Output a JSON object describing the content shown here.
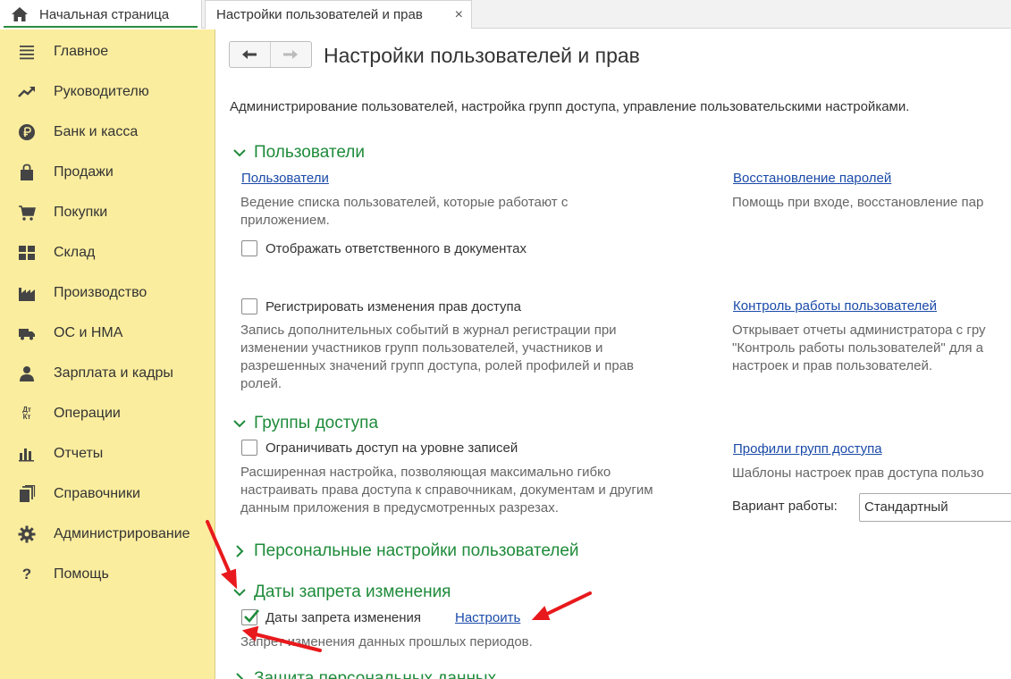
{
  "tabs": {
    "home_label": "Начальная страница",
    "active_label": "Настройки пользователей и прав",
    "close_glyph": "×"
  },
  "sidebar": {
    "items": [
      {
        "label": "Главное",
        "icon": "menu-lines-icon"
      },
      {
        "label": "Руководителю",
        "icon": "trend-up-icon"
      },
      {
        "label": "Банк и касса",
        "icon": "ruble-coin-icon"
      },
      {
        "label": "Продажи",
        "icon": "shopping-bag-icon"
      },
      {
        "label": "Покупки",
        "icon": "cart-icon"
      },
      {
        "label": "Склад",
        "icon": "warehouse-grid-icon"
      },
      {
        "label": "Производство",
        "icon": "factory-icon"
      },
      {
        "label": "ОС и НМА",
        "icon": "truck-icon"
      },
      {
        "label": "Зарплата и кадры",
        "icon": "person-icon"
      },
      {
        "label": "Операции",
        "icon": "debit-credit-icon"
      },
      {
        "label": "Отчеты",
        "icon": "bar-chart-icon"
      },
      {
        "label": "Справочники",
        "icon": "books-icon"
      },
      {
        "label": "Администрирование",
        "icon": "gear-icon"
      },
      {
        "label": "Помощь",
        "icon": "question-icon"
      }
    ],
    "debit_credit_text": "Дт Кт",
    "help_glyph": "?"
  },
  "header": {
    "back_glyph": "🡐",
    "forward_glyph": "🡒",
    "title": "Настройки пользователей и прав",
    "description": "Администрирование пользователей, настройка групп доступа, управление пользовательскими настройками."
  },
  "sections": {
    "users": {
      "title": "Пользователи",
      "users_link": "Пользователи",
      "users_hint_1": "Ведение списка пользователей, которые работают с",
      "users_hint_2": "приложением.",
      "show_responsible_label": "Отображать ответственного в документах",
      "password_recovery_link": "Восстановление паролей",
      "password_recovery_hint": "Помощь при входе, восстановление пар",
      "register_changes_label": "Регистрировать изменения прав доступа",
      "register_hint_1": "Запись дополнительных событий в журнал регистрации при",
      "register_hint_2": "изменении участников групп пользователей, участников и",
      "register_hint_3": "разрешенных значений групп доступа, ролей профилей и прав",
      "register_hint_4": "ролей.",
      "user_control_link": "Контроль работы пользователей",
      "user_control_hint_1": "Открывает отчеты администратора с гру",
      "user_control_hint_2": "\"Контроль работы пользователей\" для а",
      "user_control_hint_3": "настроек и прав пользователей."
    },
    "access_groups": {
      "title": "Группы доступа",
      "restrict_label": "Ограничивать доступ на уровне записей",
      "restrict_hint_1": "Расширенная настройка, позволяющая максимально гибко",
      "restrict_hint_2": "настраивать права доступа к справочникам, документам и другим",
      "restrict_hint_3": "данным приложения в предусмотренных разрезах.",
      "profiles_link": "Профили групп доступа",
      "profiles_hint": "Шаблоны настроек прав доступа пользо",
      "mode_label": "Вариант работы:",
      "mode_value": "Стандартный"
    },
    "personal": {
      "title": "Персональные настройки пользователей"
    },
    "change_dates": {
      "title": "Даты запрета изменения",
      "checkbox_label": "Даты запрета изменения",
      "checked": true,
      "configure_link": "Настроить",
      "hint": "Запрет изменения данных прошлых периодов."
    },
    "personal_data": {
      "title": "Защита персональных данных"
    }
  },
  "colors": {
    "sidebar_bg": "#fbed9e",
    "section_green": "#1e8b3a",
    "link_blue": "#1a4aa8",
    "annotation_red": "#e8191c"
  }
}
